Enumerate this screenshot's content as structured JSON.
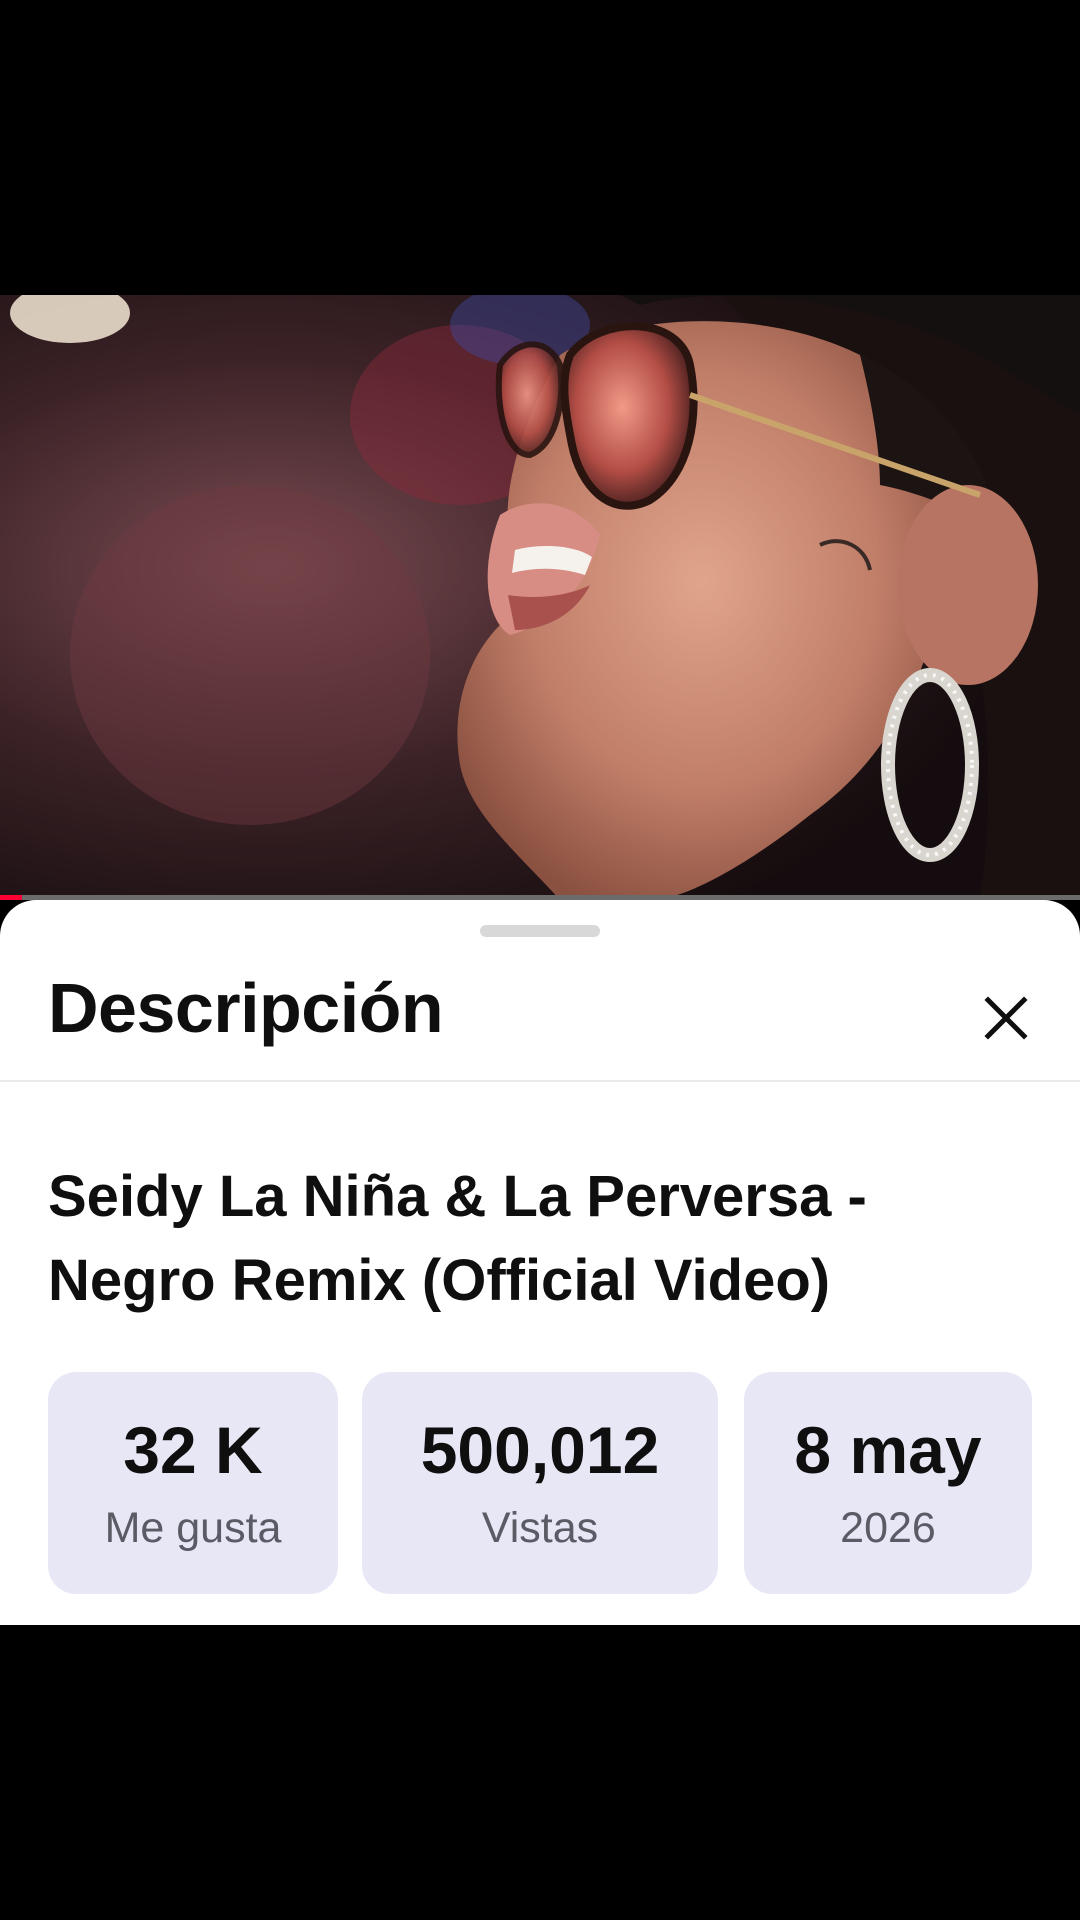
{
  "description_panel": {
    "header": "Descripción",
    "close_icon": "close-icon",
    "video_title": "Seidy La Niña & La Perversa - Negro Remix (Official Video)",
    "stats": [
      {
        "value": "32 K",
        "label": "Me gusta"
      },
      {
        "value": "500,012",
        "label": "Vistas"
      },
      {
        "value": "8 may",
        "label": "2026"
      }
    ]
  },
  "player": {
    "progress_fraction": 0.02,
    "progress_color": "#ff0033"
  },
  "colors": {
    "sheet_background": "#ffffff",
    "stat_chip_background": "#e8e7f6",
    "text_primary": "#0f0f0f",
    "text_secondary": "#5b5b66"
  }
}
